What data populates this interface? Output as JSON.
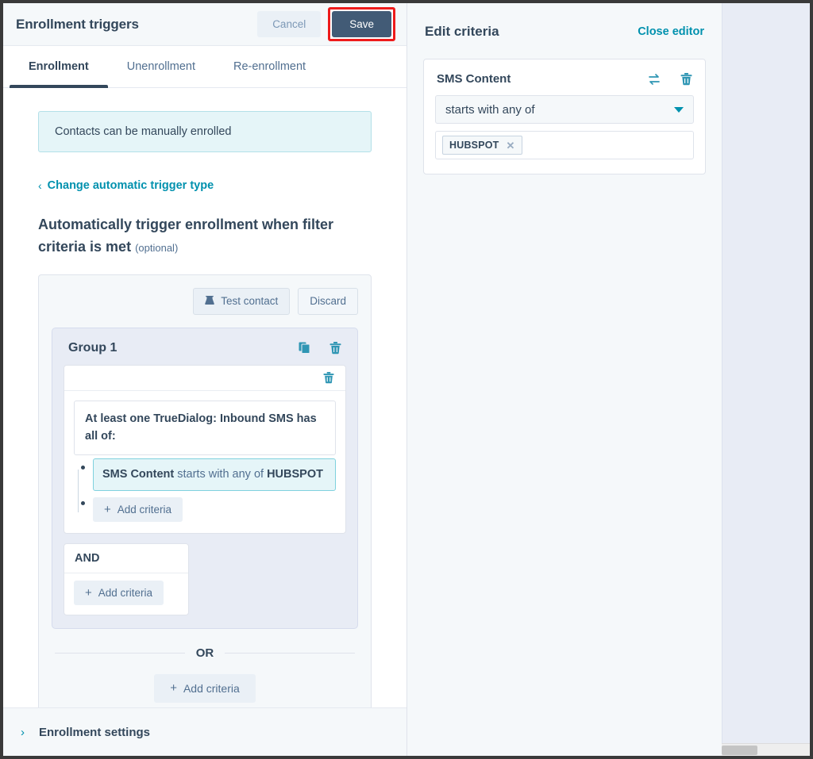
{
  "left_panel": {
    "header": {
      "title": "Enrollment triggers",
      "cancel_label": "Cancel",
      "save_label": "Save",
      "save_highlight_color": "#ee1b1b"
    },
    "tabs": [
      {
        "label": "Enrollment",
        "active": true
      },
      {
        "label": "Unenrollment",
        "active": false
      },
      {
        "label": "Re-enrollment",
        "active": false
      }
    ],
    "info_banner": "Contacts can be manually enrolled",
    "change_trigger_link": "Change automatic trigger type",
    "section_heading": "Automatically trigger enrollment when filter criteria is met",
    "section_heading_optional": "(optional)",
    "criteria": {
      "toolbar": {
        "test_contact_label": "Test contact",
        "discard_label": "Discard"
      },
      "group": {
        "title": "Group 1",
        "filter_statement": "At least one TrueDialog: Inbound SMS has all of:",
        "criterion": {
          "property": "SMS Content",
          "operator": "starts with any of",
          "value": "HUBSPOT"
        },
        "add_criteria_label": "Add criteria",
        "and_label": "AND",
        "and_add_criteria_label": "Add criteria"
      },
      "or_label": "OR",
      "bottom_add_criteria_label": "Add criteria"
    },
    "footer": {
      "label": "Enrollment settings"
    }
  },
  "right_panel": {
    "title": "Edit criteria",
    "close_editor_label": "Close editor",
    "card": {
      "field_name": "SMS Content",
      "operator_value": "starts with any of",
      "tokens": [
        {
          "label": "HUBSPOT"
        }
      ]
    }
  },
  "colors": {
    "accent_teal": "#0091ae",
    "dark_navy": "#33475b",
    "save_button": "#425b76",
    "panel_bg": "#f5f8fa",
    "highlight_red": "#ee1b1b"
  }
}
